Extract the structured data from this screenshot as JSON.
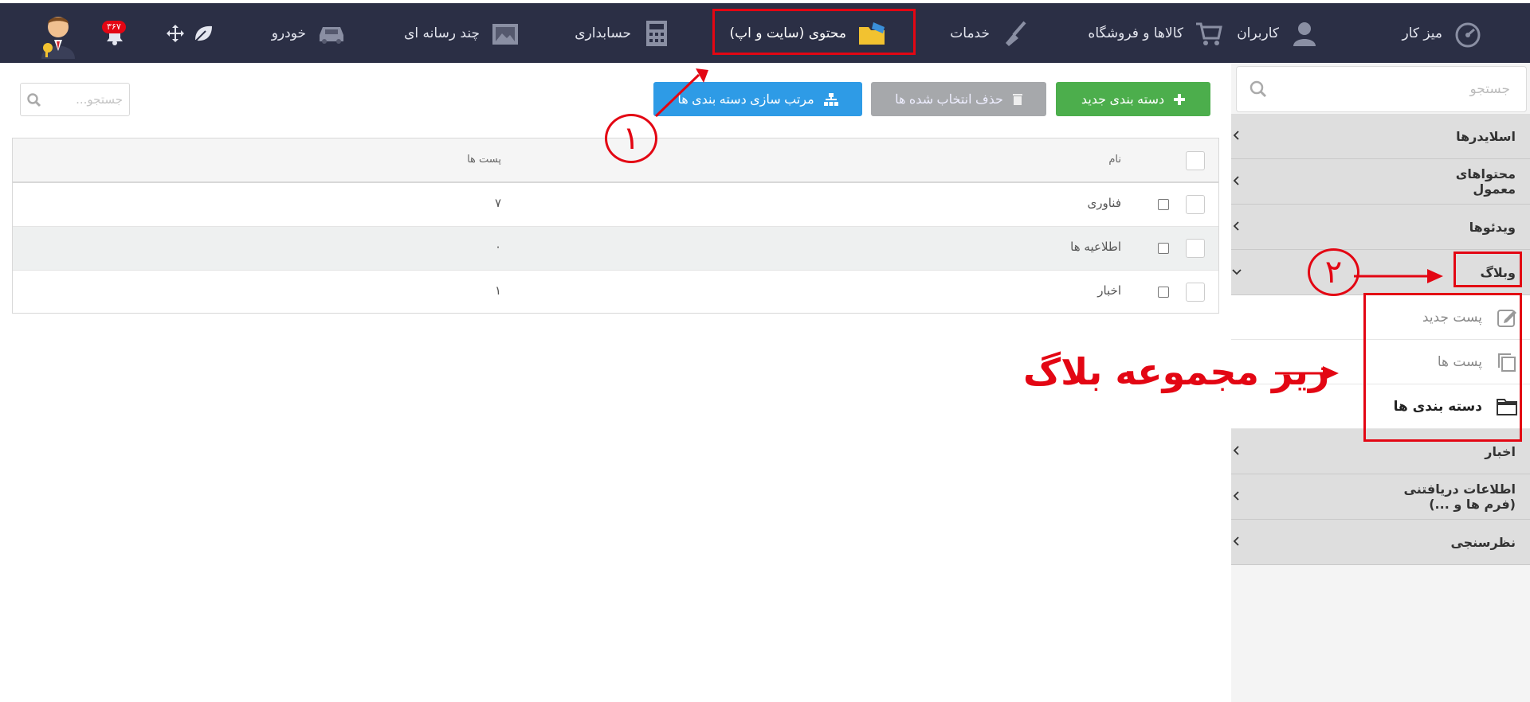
{
  "topbar": {
    "nav": [
      {
        "id": "desk",
        "label": "میز کار",
        "icon": "speedometer-icon"
      },
      {
        "id": "users",
        "label": "کاربران",
        "icon": "user-icon"
      },
      {
        "id": "shop",
        "label": "کالاها و فروشگاه",
        "icon": "cart-icon"
      },
      {
        "id": "services",
        "label": "خدمات",
        "icon": "broom-icon"
      },
      {
        "id": "content",
        "label": "محتوی (سایت و اپ)",
        "icon": "folder-icon"
      },
      {
        "id": "accounting",
        "label": "حسابداری",
        "icon": "calculator-icon"
      },
      {
        "id": "media",
        "label": "چند رسانه ای",
        "icon": "image-icon"
      },
      {
        "id": "car",
        "label": "خودرو",
        "icon": "car-icon"
      }
    ],
    "notification_count": "۳۶۷",
    "accent": "#2b2f45"
  },
  "sidebar": {
    "search_placeholder": "جستجو",
    "items": [
      {
        "label": "اسلایدرها",
        "expanded": false
      },
      {
        "label": "محتواهای معمول",
        "expanded": false
      },
      {
        "label": "ویدئوها",
        "expanded": false
      },
      {
        "label": "وبلاگ",
        "expanded": true
      },
      {
        "label": "اخبار",
        "expanded": false
      },
      {
        "label": "اطلاعات دریافتنی (فرم ها و ...)",
        "expanded": false
      },
      {
        "label": "نظرسنجی",
        "expanded": false
      }
    ],
    "blog_submenu": [
      {
        "label": "پست جدید",
        "icon": "edit-icon",
        "active": false
      },
      {
        "label": "پست ها",
        "icon": "copy-icon",
        "active": false
      },
      {
        "label": "دسته بندی ها",
        "icon": "folder-icon",
        "active": true
      }
    ]
  },
  "toolbar": {
    "new_category": "دسته بندی جدید",
    "delete_selected": "حذف انتخاب شده ها",
    "sort_categories": "مرتب سازی دسته بندی ها",
    "search_placeholder": "جستجو..."
  },
  "table": {
    "columns": [
      "نام",
      "پست ها"
    ],
    "rows": [
      {
        "name": "فناوری",
        "posts": "۷"
      },
      {
        "name": "اطلاعیه ها",
        "posts": "۰"
      },
      {
        "name": "اخبار",
        "posts": "۱"
      }
    ]
  },
  "annotations": {
    "step1": "۱",
    "step2": "۲",
    "note": "زیر مجموعه بلاگ",
    "color": "#e30613"
  }
}
